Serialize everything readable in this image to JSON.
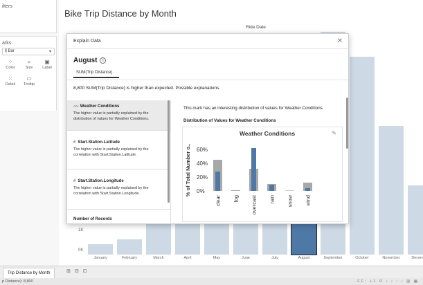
{
  "panes": {
    "filters_title": "ilters",
    "marks_title": "arks",
    "marks_type": "Bar",
    "cards": [
      {
        "label": "Color",
        "icon": "color-icon"
      },
      {
        "label": "Size",
        "icon": "size-icon"
      },
      {
        "label": "Label",
        "icon": "label-icon"
      },
      {
        "label": "Detail",
        "icon": "detail-icon"
      },
      {
        "label": "Tooltip",
        "icon": "tooltip-icon"
      }
    ]
  },
  "sheet": {
    "title": "Bike Trip Distance by Month",
    "column_header": "Ride Date",
    "y_ticks": [
      "1K",
      "0K"
    ]
  },
  "chart_data": [
    {
      "type": "bar",
      "title": "Bike Trip Distance by Month",
      "xlabel": "Ride Date",
      "ylabel": "",
      "categories": [
        "January",
        "February",
        "March",
        "April",
        "May",
        "June",
        "July",
        "August",
        "September",
        "October",
        "November",
        "December"
      ],
      "values": [
        320,
        480,
        1200,
        2000,
        2800,
        3600,
        4700,
        1400,
        7100,
        6300,
        4100,
        2200
      ],
      "selected": "August",
      "ylim": [
        0,
        7500
      ]
    },
    {
      "type": "bar",
      "title": "Weather Conditions",
      "xlabel": "",
      "ylabel": "% of Total Number o..",
      "categories": [
        "clear",
        "fog",
        "overcast",
        "rain",
        "snow",
        "wind"
      ],
      "y_ticks": [
        "60%",
        "40%",
        "20%",
        "0%"
      ],
      "series": [
        {
          "values": [
            45,
            1,
            32,
            10,
            0,
            12
          ],
          "color": "#a8a8a8"
        },
        {
          "values": [
            28,
            0,
            62,
            9,
            0,
            4
          ],
          "color": "#4e79a7"
        }
      ],
      "ylim": [
        0,
        70
      ]
    }
  ],
  "dialog": {
    "title": "Explain Data",
    "month": "August",
    "measure_tab": "SUM(Trip Distance)",
    "summary": "8,800 SUM(Trip Distance) is higher than expected. Possible explanations.",
    "items": [
      {
        "tag": "Abc",
        "title": "Weather Conditions",
        "desc": "The higher value is partially explained by the distribution of values for Weather Conditions."
      },
      {
        "tag": "#",
        "title": "Start.Station.Latitude",
        "desc": "The higher value is partially explained by the correlation with Start.Station.Latitude."
      },
      {
        "tag": "#",
        "title": "Start.Station.Longitude",
        "desc": "The higher value is partially explained by the correlation with Start.Station.Longitude."
      },
      {
        "tag": "",
        "title": "Number of Records",
        "desc": ""
      }
    ],
    "right_text": "This mark has an interesting distribution of values for Weather Conditions.",
    "dist_title": "Distribution of Values for Weather Conditions"
  },
  "tabs": {
    "active": "Trip Distance by Month"
  },
  "status": {
    "left": "p Distance): 8,800",
    "right": "FF: +1  O  ‹  ‹  ›  ›  ▥  ▦"
  },
  "colors": {
    "bar": "#cdd9e5",
    "bar_selected": "#4e79a7",
    "weather_grey": "#a8a8a8",
    "weather_blue": "#4e79a7"
  }
}
